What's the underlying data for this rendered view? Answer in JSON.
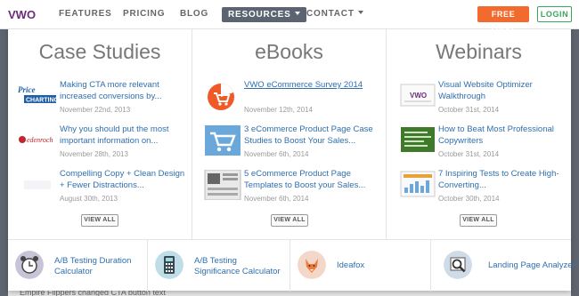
{
  "nav": {
    "logo_text": "VWO",
    "items": [
      "FEATURES",
      "PRICING",
      "BLOG",
      "RESOURCES",
      "CONTACT"
    ],
    "free_trial": "FREE TRIAL",
    "login": "LOGIN"
  },
  "menu": {
    "columns": [
      {
        "title": "Case Studies",
        "items": [
          {
            "title": "Making CTA more relevant increased conversions by...",
            "date": "November 22nd, 2013",
            "thumb": "pricecharting-logo"
          },
          {
            "title": "Why you should put the most important information on...",
            "date": "November 28th, 2013",
            "thumb": "edenroch-logo"
          },
          {
            "title": "Compelling Copy + Clean Design + Fewer Distractions...",
            "date": "August 30th, 2013",
            "thumb": "blank-logo"
          }
        ],
        "view_all": "VIEW ALL"
      },
      {
        "title": "eBooks",
        "items": [
          {
            "title": "VWO eCommerce Survey 2014",
            "date": "November 12th, 2014",
            "thumb": "pie-cart-icon"
          },
          {
            "title": "3 eCommerce Product Page Case Studies to Boost Your Sales...",
            "date": "November 6th, 2014",
            "thumb": "cart-icon"
          },
          {
            "title": "5 eCommerce Product Page Templates to Boost your Sales...",
            "date": "November 6th, 2014",
            "thumb": "template-icon"
          }
        ],
        "view_all": "VIEW ALL"
      },
      {
        "title": "Webinars",
        "items": [
          {
            "title": "Visual Website Optimizer Walkthrough",
            "date": "October 31st, 2014",
            "thumb": "vwo-slide-thumb"
          },
          {
            "title": "How to Beat Most Professional Copywriters",
            "date": "October 31st, 2014",
            "thumb": "green-slide-thumb"
          },
          {
            "title": "7 Inspiring Tests to Create High-Converting...",
            "date": "October 30th, 2014",
            "thumb": "chart-slide-thumb"
          }
        ],
        "view_all": "VIEW ALL"
      }
    ],
    "tools": [
      {
        "label": "A/B Testing Duration Calculator",
        "line1": "A/B Testing Duration",
        "line2": "Calculator",
        "icon": "alarm-clock-icon"
      },
      {
        "label": "A/B Testing Significance Calculator",
        "line1": "A/B Testing",
        "line2": "Significance Calculator",
        "icon": "calculator-icon"
      },
      {
        "label": "Ideafox",
        "line1": "Ideafox",
        "line2": "",
        "icon": "fox-icon"
      },
      {
        "label": "Landing Page Analyzer",
        "line1": "Landing Page Analyzer",
        "line2": "",
        "icon": "magnifier-icon"
      }
    ]
  },
  "background": {
    "bottom_text": "Empire Flippers changed CTA button text"
  },
  "colors": {
    "accent_orange": "#f26a2d",
    "login_green": "#3aa55d",
    "link_blue": "#2f6fb0",
    "nav_active": "#5b6470"
  }
}
